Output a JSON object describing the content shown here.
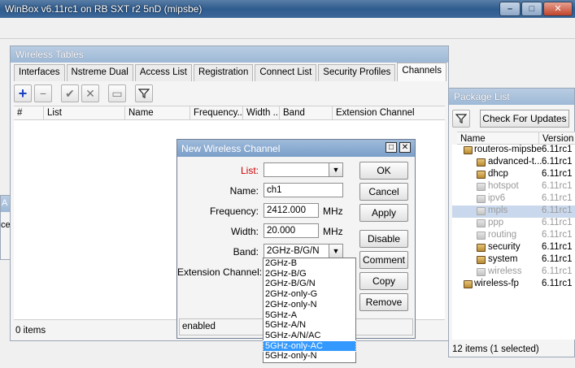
{
  "app": {
    "title": "WinBox v6.11rc1 on RB SXT r2 5nD (mipsbe)",
    "buttons": [
      "minimize",
      "maximize",
      "close"
    ]
  },
  "colors": {
    "titlebar": "#2f5c8f",
    "selection": "#3399ff",
    "required_label": "#d00000",
    "disabled_text": "#9a9a9a"
  },
  "wireless_tables": {
    "title": "Wireless Tables",
    "tabs": [
      "Interfaces",
      "Nstreme Dual",
      "Access List",
      "Registration",
      "Connect List",
      "Security Profiles",
      "Channels"
    ],
    "active_tab": "Channels",
    "toolbar_icons": [
      "add-icon",
      "remove-icon",
      "enable-icon",
      "disable-icon",
      "comment-icon",
      "filter-icon"
    ],
    "columns": [
      "#",
      "List",
      "Name",
      "Frequency...",
      "Width ...",
      "Band",
      "Extension Channel"
    ],
    "status": "0 items"
  },
  "new_channel_dialog": {
    "title": "New Wireless Channel",
    "fields": {
      "list": {
        "label": "List:",
        "value": ""
      },
      "name": {
        "label": "Name:",
        "value": "ch1"
      },
      "frequency": {
        "label": "Frequency:",
        "value": "2412.000",
        "unit": "MHz"
      },
      "width": {
        "label": "Width:",
        "value": "20.000",
        "unit": "MHz"
      },
      "band": {
        "label": "Band:",
        "value": "2GHz-B/G/N"
      },
      "extension_channel": {
        "label": "Extension Channel:"
      }
    },
    "buttons": [
      "OK",
      "Cancel",
      "Apply",
      "Disable",
      "Comment",
      "Copy",
      "Remove"
    ],
    "status": "enabled"
  },
  "band_dropdown": {
    "options": [
      "2GHz-B",
      "2GHz-B/G",
      "2GHz-B/G/N",
      "2GHz-only-G",
      "2GHz-only-N",
      "5GHz-A",
      "5GHz-A/N",
      "5GHz-A/N/AC",
      "5GHz-only-AC",
      "5GHz-only-N"
    ],
    "selected": "5GHz-only-AC"
  },
  "package_list": {
    "title": "Package List",
    "check_button": "Check For Updates",
    "columns": [
      "Name",
      "Version"
    ],
    "rows": [
      {
        "name": "routeros-mipsbe",
        "version": "6.11rc1"
      },
      {
        "name": "advanced-t...",
        "version": "6.11rc1"
      },
      {
        "name": "dhcp",
        "version": "6.11rc1"
      },
      {
        "name": "hotspot",
        "version": "6.11rc1"
      },
      {
        "name": "ipv6",
        "version": "6.11rc1"
      },
      {
        "name": "mpls",
        "version": "6.11rc1"
      },
      {
        "name": "ppp",
        "version": "6.11rc1"
      },
      {
        "name": "routing",
        "version": "6.11rc1"
      },
      {
        "name": "security",
        "version": "6.11rc1"
      },
      {
        "name": "system",
        "version": "6.11rc1"
      },
      {
        "name": "wireless",
        "version": "6.11rc1"
      },
      {
        "name": "wireless-fp",
        "version": "6.11rc1"
      }
    ],
    "status": "12 items (1 selected)"
  },
  "left_window": {
    "title_fragment": "A",
    "text_fragment": "ce"
  }
}
